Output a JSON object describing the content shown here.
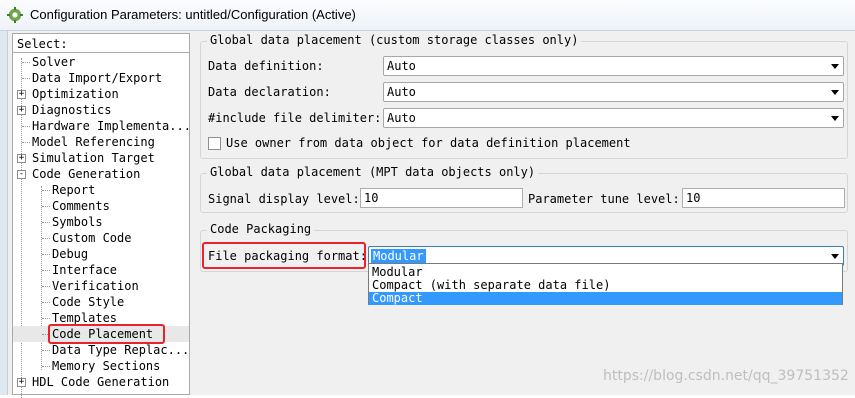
{
  "window": {
    "title": "Configuration Parameters: untitled/Configuration (Active)",
    "icon": "gear-icon"
  },
  "tree": {
    "header": "Select:",
    "items": [
      {
        "label": "Solver",
        "level": 0,
        "expander": ""
      },
      {
        "label": "Data Import/Export",
        "level": 0,
        "expander": ""
      },
      {
        "label": "Optimization",
        "level": 0,
        "expander": "+"
      },
      {
        "label": "Diagnostics",
        "level": 0,
        "expander": "+"
      },
      {
        "label": "Hardware Implementa...",
        "level": 0,
        "expander": ""
      },
      {
        "label": "Model Referencing",
        "level": 0,
        "expander": ""
      },
      {
        "label": "Simulation Target",
        "level": 0,
        "expander": "+"
      },
      {
        "label": "Code Generation",
        "level": 0,
        "expander": "-"
      },
      {
        "label": "Report",
        "level": 1,
        "expander": ""
      },
      {
        "label": "Comments",
        "level": 1,
        "expander": ""
      },
      {
        "label": "Symbols",
        "level": 1,
        "expander": ""
      },
      {
        "label": "Custom Code",
        "level": 1,
        "expander": ""
      },
      {
        "label": "Debug",
        "level": 1,
        "expander": ""
      },
      {
        "label": "Interface",
        "level": 1,
        "expander": ""
      },
      {
        "label": "Verification",
        "level": 1,
        "expander": ""
      },
      {
        "label": "Code Style",
        "level": 1,
        "expander": ""
      },
      {
        "label": "Templates",
        "level": 1,
        "expander": ""
      },
      {
        "label": "Code Placement",
        "level": 1,
        "expander": "",
        "selected": true
      },
      {
        "label": "Data Type Replac...",
        "level": 1,
        "expander": ""
      },
      {
        "label": "Memory Sections",
        "level": 1,
        "expander": ""
      },
      {
        "label": "HDL Code Generation",
        "level": 0,
        "expander": "+"
      }
    ]
  },
  "custom_storage": {
    "title": "Global data placement (custom storage classes only)",
    "data_definition_label": "Data definition:",
    "data_definition_value": "Auto",
    "data_declaration_label": "Data declaration:",
    "data_declaration_value": "Auto",
    "include_delimiter_label": "#include file delimiter:",
    "include_delimiter_value": "Auto",
    "use_owner_label": "Use owner from data object for data definition placement",
    "use_owner_checked": false
  },
  "mpt": {
    "title": "Global data placement (MPT data objects only)",
    "signal_display_label": "Signal display level:",
    "signal_display_value": "10",
    "parameter_tune_label": "Parameter tune level:",
    "parameter_tune_value": "10"
  },
  "packaging": {
    "title": "Code Packaging",
    "format_label": "File packaging format:",
    "format_value": "Modular",
    "options": [
      {
        "label": "Modular",
        "highlighted": false
      },
      {
        "label": "Compact (with separate data file)",
        "highlighted": false
      },
      {
        "label": "Compact",
        "highlighted": true
      }
    ]
  },
  "watermark": "https://blog.csdn.net/qq_39751352",
  "colors": {
    "highlight_box": "#e8232b",
    "selection": "#3399ff"
  }
}
